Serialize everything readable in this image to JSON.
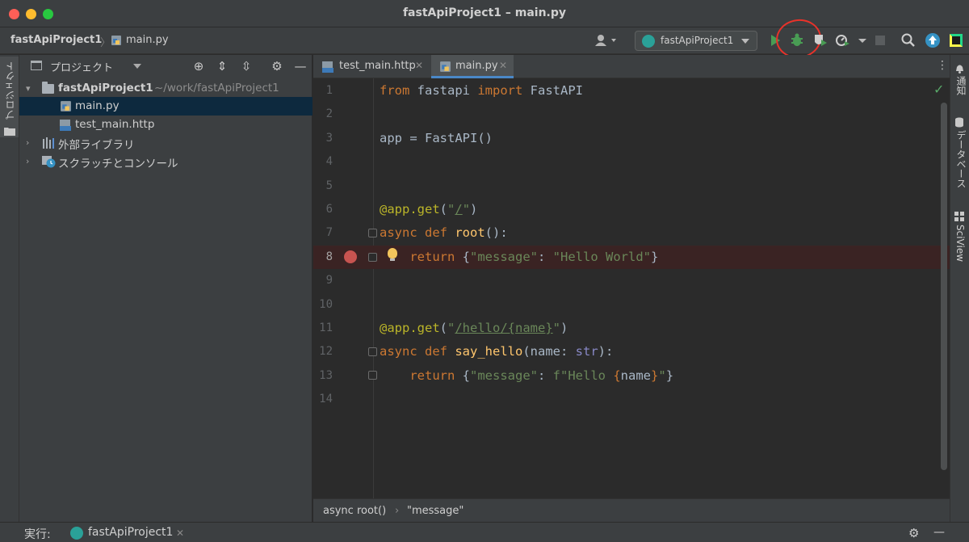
{
  "window": {
    "title": "fastApiProject1 – main.py"
  },
  "navbar": {
    "project": "fastApiProject1",
    "separator": "〉",
    "file": "main.py",
    "run_config": "fastApiProject1"
  },
  "left_stripe": {
    "project_tab": "プロジェクト"
  },
  "project_pane": {
    "title": "プロジェクト",
    "tree": [
      {
        "label": "fastApiProject1",
        "path": "~/work/fastApiProject1",
        "expanded": "true"
      },
      {
        "label": "main.py",
        "selected": "true"
      },
      {
        "label": "test_main.http"
      },
      {
        "label": "外部ライブラリ"
      },
      {
        "label": "スクラッチとコンソール"
      }
    ]
  },
  "editor_tabs": [
    {
      "label": "test_main.http",
      "active": "false"
    },
    {
      "label": "main.py",
      "active": "true"
    }
  ],
  "editor": {
    "line_numbers": [
      "1",
      "2",
      "3",
      "4",
      "5",
      "6",
      "7",
      "8",
      "9",
      "10",
      "11",
      "12",
      "13",
      "14"
    ],
    "current_line": 8,
    "breakpoint_line": 8
  },
  "editor_breadcrumb": {
    "function": "async root()",
    "separator": "›",
    "item": "\"message\""
  },
  "right_stripe": {
    "notifications": "通知",
    "database": "データベース",
    "sciview": "SciView"
  },
  "bottom_bar": {
    "run_label": "実行:",
    "run_config": "fastApiProject1"
  },
  "colors": {
    "keyword": "#cc7832",
    "decorator": "#bbb529",
    "string": "#6a8759",
    "function": "#ffc66d",
    "default_text": "#a9b7c6",
    "breakpoint": "#c75450",
    "annotation_circle": "#e8322a"
  }
}
